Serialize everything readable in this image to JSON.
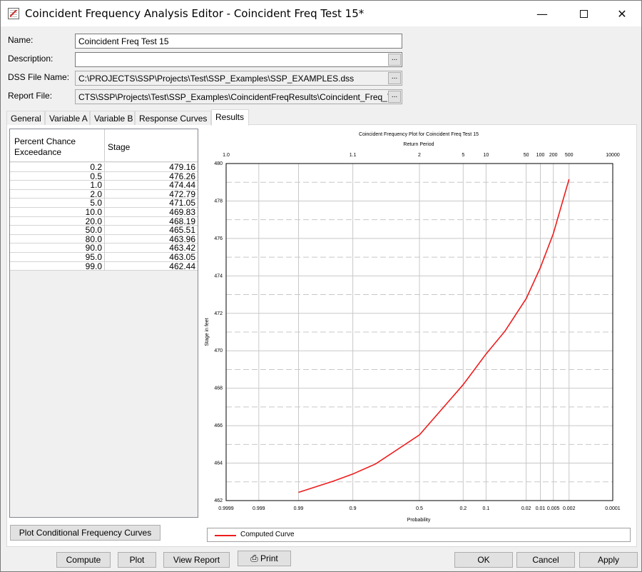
{
  "window": {
    "title": "Coincident Frequency Analysis Editor - Coincident Freq Test 15*",
    "minimize_label": "—",
    "maximize_label": "",
    "close_label": "✕"
  },
  "form": {
    "name_label": "Name:",
    "name_value": "Coincident Freq Test 15",
    "description_label": "Description:",
    "description_value": "",
    "dss_label": "DSS File Name:",
    "dss_value": "C:\\PROJECTS\\SSP\\Projects\\Test\\SSP_Examples\\SSP_EXAMPLES.dss",
    "report_label": "Report File:",
    "report_value": "CTS\\SSP\\Projects\\Test\\SSP_Examples\\CoincidentFreqResults\\Coincident_Freq_Te",
    "browse_label": "..."
  },
  "tabs": [
    {
      "label": "General",
      "active": false
    },
    {
      "label": "Variable A",
      "active": false
    },
    {
      "label": "Variable B",
      "active": false
    },
    {
      "label": "Response Curves",
      "active": false
    },
    {
      "label": "Results",
      "active": true
    }
  ],
  "results_table": {
    "columns": [
      "Percent Chance Exceedance",
      "Stage"
    ],
    "col1_line1": "Percent Chance",
    "col1_line2": "Exceedance",
    "rows": [
      [
        "0.2",
        "479.16"
      ],
      [
        "0.5",
        "476.26"
      ],
      [
        "1.0",
        "474.44"
      ],
      [
        "2.0",
        "472.79"
      ],
      [
        "5.0",
        "471.05"
      ],
      [
        "10.0",
        "469.83"
      ],
      [
        "20.0",
        "468.19"
      ],
      [
        "50.0",
        "465.51"
      ],
      [
        "80.0",
        "463.96"
      ],
      [
        "90.0",
        "463.42"
      ],
      [
        "95.0",
        "463.05"
      ],
      [
        "99.0",
        "462.44"
      ]
    ]
  },
  "buttons": {
    "plot_conditional": "Plot Conditional Frequency Curves",
    "compute": "Compute",
    "plot": "Plot",
    "view_report": "View Report",
    "print": "Print",
    "ok": "OK",
    "cancel": "Cancel",
    "apply": "Apply"
  },
  "legend": {
    "entries": [
      {
        "label": "Computed Curve",
        "color": "#ee1c1c"
      }
    ]
  },
  "chart_data": {
    "type": "line",
    "title": "Coincident Frequency Plot for Coincident Freq Test 15",
    "top_axis_label": "Return Period",
    "xlabel": "Probability",
    "ylabel": "Stage in feet",
    "x_scale": "normal-probability",
    "x_reversed": true,
    "xlim": [
      0.9999,
      0.0001
    ],
    "ylim": [
      462,
      480
    ],
    "grid": true,
    "legend_position": "bottom",
    "x_ticks": [
      {
        "p": 0.9999,
        "label": "0.9999"
      },
      {
        "p": 0.999,
        "label": "0.999"
      },
      {
        "p": 0.99,
        "label": "0.99"
      },
      {
        "p": 0.9,
        "label": "0.9"
      },
      {
        "p": 0.5,
        "label": "0.5"
      },
      {
        "p": 0.2,
        "label": "0.2"
      },
      {
        "p": 0.1,
        "label": "0.1"
      },
      {
        "p": 0.02,
        "label": "0.02"
      },
      {
        "p": 0.01,
        "label": "0.01"
      },
      {
        "p": 0.005,
        "label": "0.005"
      },
      {
        "p": 0.002,
        "label": "0.002"
      },
      {
        "p": 0.0001,
        "label": "0.0001"
      }
    ],
    "top_ticks": [
      {
        "p": 0.9999,
        "label": "1.0"
      },
      {
        "p": 0.9,
        "label": "1.1"
      },
      {
        "p": 0.5,
        "label": "2"
      },
      {
        "p": 0.2,
        "label": "5"
      },
      {
        "p": 0.1,
        "label": "10"
      },
      {
        "p": 0.02,
        "label": "50"
      },
      {
        "p": 0.01,
        "label": "100"
      },
      {
        "p": 0.005,
        "label": "200"
      },
      {
        "p": 0.002,
        "label": "500"
      },
      {
        "p": 0.0001,
        "label": "10000"
      }
    ],
    "y_ticks": [
      462,
      464,
      466,
      468,
      470,
      472,
      474,
      476,
      478,
      480
    ],
    "y_minor_dashed": [
      463,
      465,
      467,
      469,
      471,
      473,
      475,
      477,
      479
    ],
    "series": [
      {
        "name": "Computed Curve",
        "color": "#ee1c1c",
        "x": [
          0.99,
          0.95,
          0.9,
          0.8,
          0.5,
          0.2,
          0.1,
          0.05,
          0.02,
          0.01,
          0.005,
          0.002
        ],
        "y": [
          462.44,
          463.05,
          463.42,
          463.96,
          465.51,
          468.19,
          469.83,
          471.05,
          472.79,
          474.44,
          476.26,
          479.16
        ]
      }
    ]
  }
}
